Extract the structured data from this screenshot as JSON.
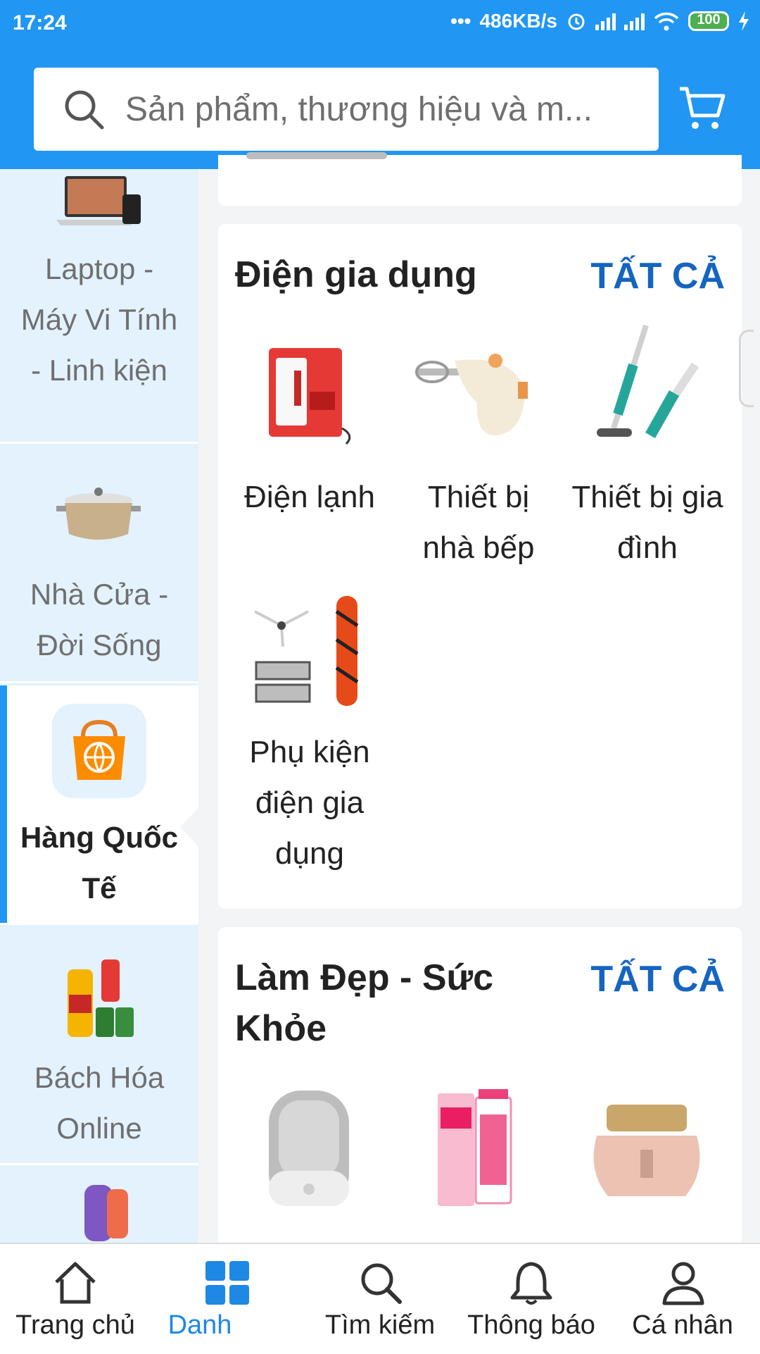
{
  "status_bar": {
    "time": "17:24",
    "network_speed": "486KB/s",
    "battery": "100"
  },
  "search": {
    "placeholder": "Sản phẩm, thương hiệu và m..."
  },
  "categories": [
    {
      "label": "Laptop - Máy Vi Tính - Linh kiện",
      "icon": "laptop-icon"
    },
    {
      "label": "Nhà Cửa - Đời Sống",
      "icon": "cookware-icon"
    },
    {
      "label": "Hàng Quốc Tế",
      "icon": "global-shopping-bag-icon",
      "active": true
    },
    {
      "label": "Bách Hóa Online",
      "icon": "grocery-icon"
    }
  ],
  "sections": [
    {
      "title": "Điện gia dụng",
      "see_all": "TẤT CẢ",
      "items": [
        {
          "label": "Điện lạnh",
          "icon": "mini-fridge-image"
        },
        {
          "label": "Thiết bị nhà bếp",
          "icon": "hand-mixer-image"
        },
        {
          "label": "Thiết bị gia đình",
          "icon": "vacuum-cleaner-image"
        },
        {
          "label": "Phụ kiện điện gia dụng",
          "icon": "vacuum-accessories-image"
        }
      ]
    },
    {
      "title": "Làm Đẹp - Sức Khỏe",
      "see_all": "TẤT CẢ",
      "items": [
        {
          "label": "",
          "icon": "face-cleanser-image"
        },
        {
          "label": "",
          "icon": "cream-tubes-image"
        },
        {
          "label": "",
          "icon": "cream-jar-image"
        }
      ]
    }
  ],
  "bottom_nav": [
    {
      "label": "Trang chủ",
      "icon": "home-icon"
    },
    {
      "label": "Danh",
      "icon": "grid-icon",
      "active": true
    },
    {
      "label": "Tìm kiếm",
      "icon": "search-icon"
    },
    {
      "label": "Thông báo",
      "icon": "bell-icon"
    },
    {
      "label": "Cá nhân",
      "icon": "user-icon"
    }
  ],
  "colors": {
    "primary": "#2196f3",
    "link": "#1565c0",
    "sidebar_bg": "#e3f2fd"
  }
}
